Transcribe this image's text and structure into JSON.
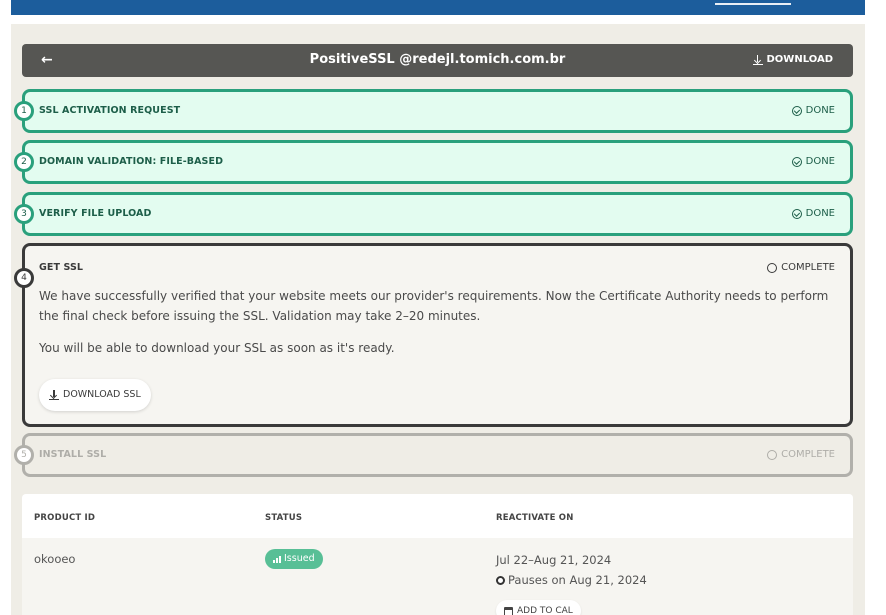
{
  "header": {
    "title": "PositiveSSL @redejl.tomich.com.br",
    "download_label": "DOWNLOAD"
  },
  "steps": [
    {
      "num": "1",
      "label": "SSL ACTIVATION REQUEST",
      "status": "DONE",
      "state": "done"
    },
    {
      "num": "2",
      "label": "DOMAIN VALIDATION: FILE-BASED",
      "status": "DONE",
      "state": "done"
    },
    {
      "num": "3",
      "label": "VERIFY FILE UPLOAD",
      "status": "DONE",
      "state": "done"
    },
    {
      "num": "4",
      "label": "GET SSL",
      "status": "COMPLETE",
      "state": "active",
      "paragraph1": "We have successfully verified that your website meets our provider's requirements. Now the Certificate Authority needs to perform the final check before issuing the SSL. Validation may take 2–20 minutes.",
      "paragraph2": "You will be able to download your SSL as soon as it's ready.",
      "button": "DOWNLOAD SSL"
    },
    {
      "num": "5",
      "label": "INSTALL SSL",
      "status": "COMPLETE",
      "state": "pending"
    }
  ],
  "table": {
    "headers": [
      "PRODUCT ID",
      "STATUS",
      "REACTIVATE ON"
    ],
    "row": {
      "product_id": "okooeo",
      "status": "Issued",
      "reactivate_range": "Jul 22–Aug 21, 2024",
      "pause_note": "Pauses on Aug 21, 2024",
      "add_to_cal": "ADD TO CAL"
    }
  },
  "colors": {
    "nav": "#1c5d9c",
    "header_bg": "#565653",
    "done_border": "#2aa07c",
    "done_bg": "#e3fcf0",
    "active_border": "#3a3a3a",
    "pending_border": "#b1b0ab",
    "badge": "#58bf96"
  },
  "icons": {
    "back": "arrow-left-icon",
    "download": "download-icon",
    "done": "check-circle-icon",
    "pending": "circle-icon",
    "status": "signal-bars-icon",
    "pause": "radio-dot-icon",
    "calendar": "calendar-icon"
  }
}
